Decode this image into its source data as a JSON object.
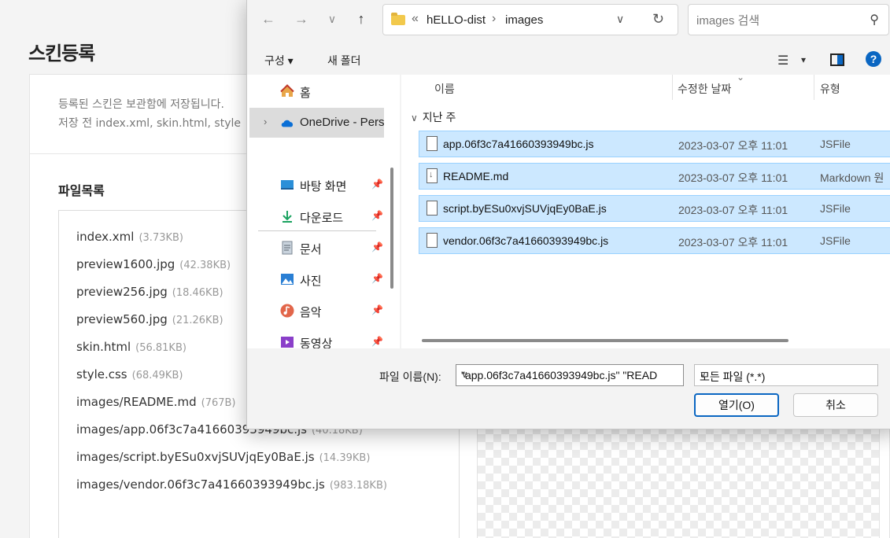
{
  "page": {
    "title": "스킨등록",
    "notice_line1": "등록된 스킨은 보관함에 저장됩니다.",
    "notice_line2": "저장 전 index.xml, skin.html, style",
    "filelist_title": "파일목록",
    "files": [
      {
        "name": "index.xml",
        "size": "(3.73KB)"
      },
      {
        "name": "preview1600.jpg",
        "size": "(42.38KB)"
      },
      {
        "name": "preview256.jpg",
        "size": "(18.46KB)"
      },
      {
        "name": "preview560.jpg",
        "size": "(21.26KB)"
      },
      {
        "name": "skin.html",
        "size": "(56.81KB)"
      },
      {
        "name": "style.css",
        "size": "(68.49KB)"
      },
      {
        "name": "images/README.md",
        "size": "(767B)"
      },
      {
        "name": "images/app.06f3c7a41660393949bc.js",
        "size": "(40.18KB)"
      },
      {
        "name": "images/script.byESu0xvjSUVjqEy0BaE.js",
        "size": "(14.39KB)"
      },
      {
        "name": "images/vendor.06f3c7a41660393949bc.js",
        "size": "(983.18KB)"
      }
    ]
  },
  "dialog": {
    "nav": {
      "back": "←",
      "forward": "→",
      "recent": "∨",
      "up": "↑"
    },
    "address": {
      "chevrons": "«",
      "seg1": "hELLO-dist",
      "sep": "›",
      "seg2": "images",
      "dropdown": "∨",
      "refresh": "↻"
    },
    "search_placeholder": "images 검색",
    "search_icon": "⚲",
    "commands": {
      "organize": "구성 ▾",
      "new_folder": "새 폴더",
      "view": "☰",
      "view_dd": "▾",
      "help": "?"
    },
    "nav_items": [
      {
        "label": "홈",
        "icon": "home-icon"
      },
      {
        "label": "OneDrive - Pers",
        "icon": "cloud-icon",
        "chevron": "›"
      },
      {
        "label": "바탕 화면",
        "icon": "desktop-icon",
        "pin": "📌"
      },
      {
        "label": "다운로드",
        "icon": "download-icon",
        "pin": "📌"
      },
      {
        "label": "문서",
        "icon": "document-icon",
        "pin": "📌"
      },
      {
        "label": "사진",
        "icon": "pictures-icon",
        "pin": "📌"
      },
      {
        "label": "음악",
        "icon": "music-icon",
        "pin": "📌"
      },
      {
        "label": "동영상",
        "icon": "video-icon",
        "pin": "📌"
      }
    ],
    "columns": {
      "name": "이름",
      "date": "수정한 날짜",
      "type": "유형",
      "sort": "⌄"
    },
    "group": "지난 주",
    "group_chevron": "∨",
    "files": [
      {
        "name": "app.06f3c7a41660393949bc.js",
        "date": "2023-03-07 오후 11:01",
        "type": "JSFile"
      },
      {
        "name": "README.md",
        "date": "2023-03-07 오후 11:01",
        "type": "Markdown 원"
      },
      {
        "name": "script.byESu0xvjSUVjqEy0BaE.js",
        "date": "2023-03-07 오후 11:01",
        "type": "JSFile"
      },
      {
        "name": "vendor.06f3c7a41660393949bc.js",
        "date": "2023-03-07 오후 11:01",
        "type": "JSFile"
      }
    ],
    "filename_label": "파일 이름(N):",
    "filename_value": "\"app.06f3c7a41660393949bc.js\" \"READ",
    "filetype_value": "모든 파일 (*.*)",
    "dd": "∨",
    "open_label": "열기(O)",
    "cancel_label": "취소"
  }
}
